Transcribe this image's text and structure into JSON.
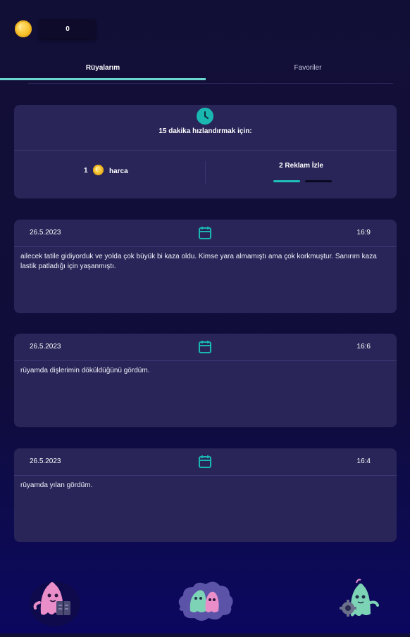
{
  "header": {
    "coin_balance": "0"
  },
  "tabs": [
    {
      "label": "Rüyalarım",
      "active": true
    },
    {
      "label": "Favoriler",
      "active": false
    }
  ],
  "boost": {
    "title": "15 dakika hızlandırmak için:",
    "spend_amount": "1",
    "spend_label": "harca",
    "ads_label": "2 Reklam İzle",
    "ads_progress": {
      "watched": 1,
      "total": 2
    }
  },
  "dreams": [
    {
      "date": "26.5.2023",
      "time": "16:9",
      "text": "ailecek tatile gidiyorduk ve yolda çok büyük bi kaza oldu. Kimse yara almamıştı ama çok korkmuştur. Sanırım kaza lastik patladığı için yaşanmıştı."
    },
    {
      "date": "26.5.2023",
      "time": "16:6",
      "text": "rüyamda dişlerimin döküldüğünü gördüm."
    },
    {
      "date": "26.5.2023",
      "time": "16:4",
      "text": "rüyamda yılan gördüm."
    }
  ],
  "bottom_nav": [
    {
      "icon": "ghost-book-icon"
    },
    {
      "icon": "ghost-pair-cloud-icon"
    },
    {
      "icon": "ghost-settings-icon"
    }
  ],
  "colors": {
    "accent": "#19b7b0",
    "card": "#292558",
    "background": "#120f37",
    "coin": "#f6c22d"
  }
}
